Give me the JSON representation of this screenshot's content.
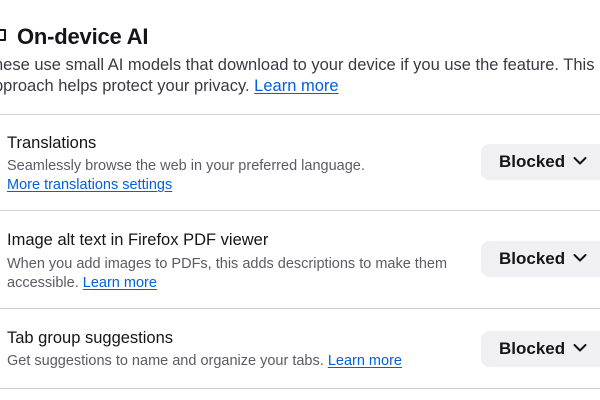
{
  "section": {
    "title": "On-device AI",
    "icon": "chat-bubble-icon",
    "description_line1": "hese use small AI models that download to your device if you use the feature. This",
    "description_line2_prefix": "pproach helps protect your privacy.",
    "learn_more": "Learn more"
  },
  "features": [
    {
      "title": "Translations",
      "description": "Seamlessly browse the web in your preferred language.",
      "link": "More translations settings",
      "status": "Blocked"
    },
    {
      "title": "Image alt text in Firefox PDF viewer",
      "description_line1": "When you add images to PDFs, this adds descriptions to make them",
      "description_line2_prefix": "accessible.",
      "link": "Learn more",
      "status": "Blocked"
    },
    {
      "title": "Tab group suggestions",
      "description_prefix": "Get suggestions to name and organize your tabs.",
      "link": "Learn more",
      "status": "Blocked"
    }
  ],
  "colors": {
    "text": "#15141a",
    "secondary_text": "#5b5b66",
    "link": "#0061e0",
    "dropdown_bg": "#f0f0f4",
    "divider": "#cfcfd8"
  }
}
